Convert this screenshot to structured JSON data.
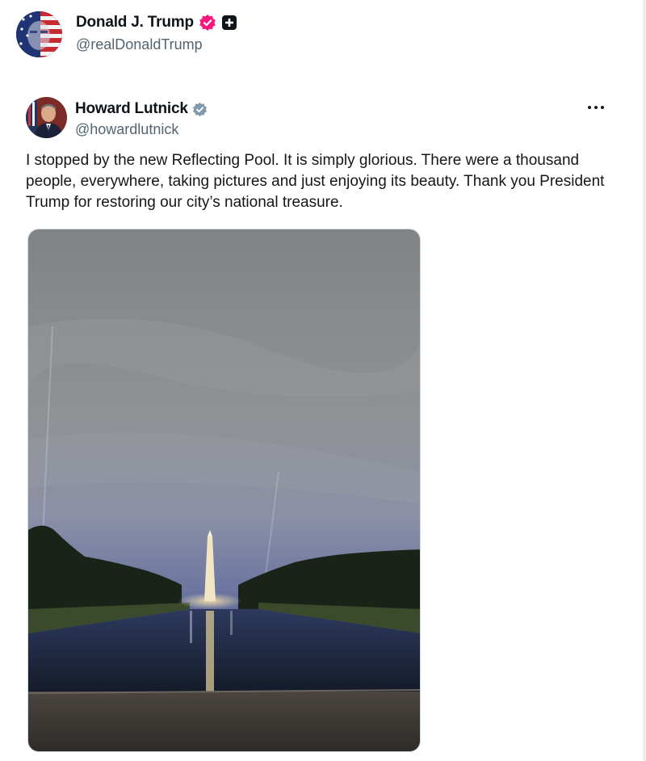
{
  "outer_post": {
    "author_name": "Donald J. Trump",
    "author_handle": "@realDonaldTrump",
    "verified_badge_color": "#f91880",
    "icons": [
      "verified-badge-icon",
      "plus-square-icon"
    ]
  },
  "quoted_post": {
    "author_name": "Howard Lutnick",
    "author_handle": "@howardlutnick",
    "verified_badge_color": "#829aab",
    "text": "I stopped by the new Reflecting Pool. It is simply glorious. There were a thousand people, everywhere, taking pictures and just  enjoying its beauty. Thank you President Trump for restoring our city’s national treasure.",
    "icons": [
      "verified-badge-icon",
      "more-options-icon"
    ]
  },
  "colors": {
    "text_primary": "#0f1419",
    "text_secondary": "#536471"
  }
}
